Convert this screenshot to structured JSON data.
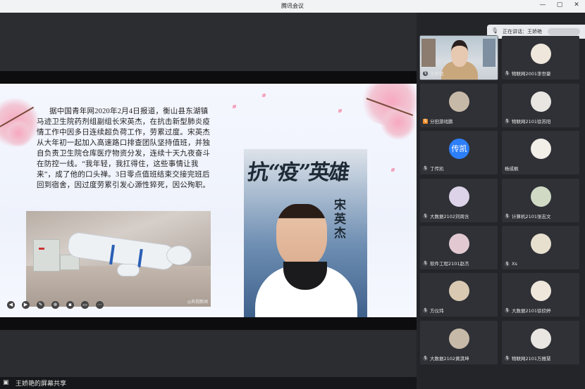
{
  "window": {
    "title": "腾讯会议",
    "controls": [
      "—",
      "▢",
      "✕"
    ]
  },
  "share": {
    "slide_text": "据中国青年网2020年2月4日报道，衡山县东湖镇马迹卫生院药剂组副组长宋英杰，在抗击新型肺炎疫情工作中因多日连续超负荷工作，劳累过度。宋英杰从大年初一起加入高速路口排查团队坚持值班，并独自负责卫生院仓库医疗物资分发，连续十天九夜奋斗在防控一线。“我年轻，我扛得住，这些事情让我来”，成了他的口头禅。3日零点值班结束交接完班后回到宿舍，因过度劳累引发心源性猝死，因公殉职。",
    "poster_title": "抗“疫”英雄",
    "poster_name": "宋英杰",
    "photo_watermark": "◎央视新闻"
  },
  "share_bar": {
    "label": "王娇艳的屏幕共享",
    "icon": "screen-share-icon"
  },
  "speaking": {
    "label": "正在讲话：王娇艳"
  },
  "participants": [
    {
      "name": "王娇艳",
      "mic": "mic-on",
      "video": true
    },
    {
      "name": "物联网2001李世豪",
      "mic": "mic-off"
    },
    {
      "name": "分田游戏鹏",
      "mic": "mic-off",
      "badge": "orange"
    },
    {
      "name": "物联网2101徐苏阳",
      "mic": "mic-off"
    },
    {
      "name": "丁传凯",
      "mic": "mic-off",
      "avatar_text": "传凯"
    },
    {
      "name": "杨成枫",
      "mic": ""
    },
    {
      "name": "大数据2102刘周含",
      "mic": "mic-off"
    },
    {
      "name": "计算机2101张志文",
      "mic": "mic-off"
    },
    {
      "name": "软件工程2101赵杰",
      "mic": "mic-off"
    },
    {
      "name": "Xs",
      "mic": "mic-off"
    },
    {
      "name": "方仪玮",
      "mic": "mic-off"
    },
    {
      "name": "大数据2101徐欣婷",
      "mic": "mic-off"
    },
    {
      "name": "大数据2102黄淇坤",
      "mic": "mic-off"
    },
    {
      "name": "物联网2101万雅慧",
      "mic": "mic-off"
    }
  ],
  "colors": {
    "accent": "#2d7ff9",
    "panel": "#232529",
    "tile": "#2f3136"
  }
}
